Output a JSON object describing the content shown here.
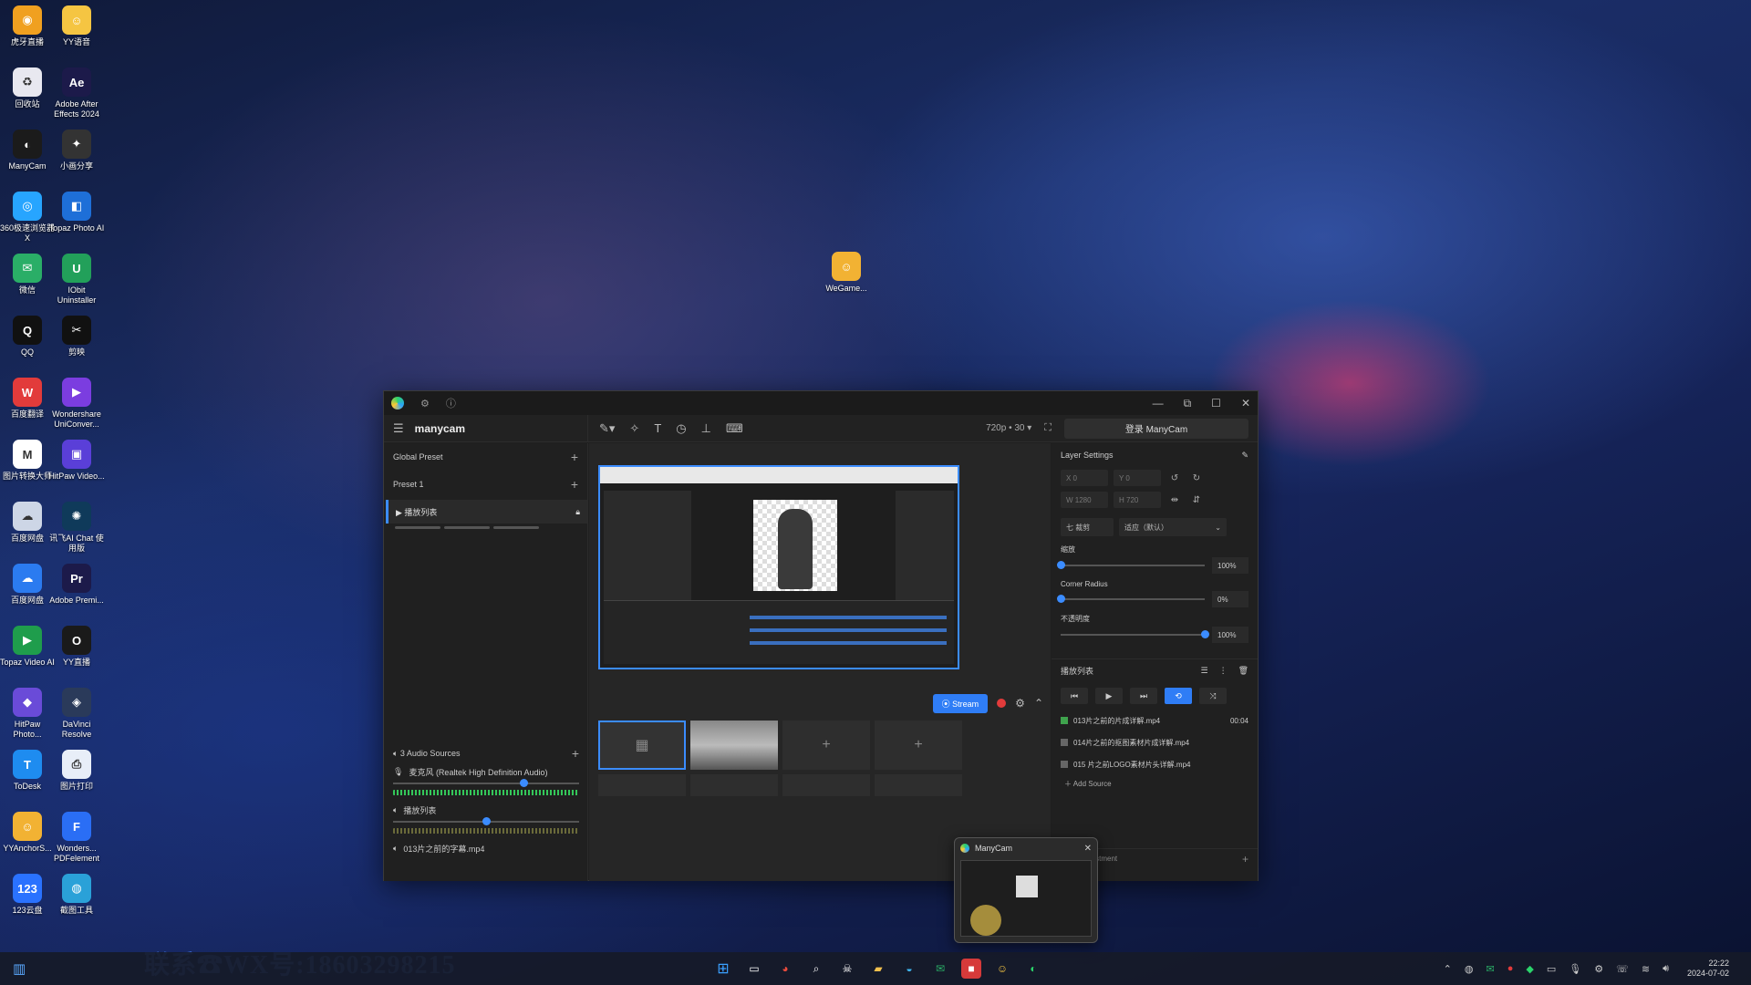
{
  "desktop": {
    "icons_col1": [
      {
        "name": "虎牙直播",
        "icon": "huya-icon",
        "color": "#f0a020",
        "glyph": "◉"
      },
      {
        "name": "回收站",
        "icon": "recycle-bin-icon",
        "color": "#e8e8f0",
        "glyph": "♻"
      },
      {
        "name": "ManyCam",
        "icon": "manycam-icon",
        "color": "#1b1b1b",
        "glyph": "◐"
      },
      {
        "name": "360极速浏览器X",
        "icon": "browser-360-icon",
        "color": "#27a5ff",
        "glyph": "◎"
      },
      {
        "name": "微信",
        "icon": "wechat-icon",
        "color": "#2aae67",
        "glyph": "✉"
      },
      {
        "name": "QQ",
        "icon": "qq-icon",
        "color": "#111111",
        "glyph": "Q"
      },
      {
        "name": "百度翻译",
        "icon": "webtts-icon",
        "color": "#e23b3b",
        "glyph": "W"
      },
      {
        "name": "图片转换大师",
        "icon": "gmail-like-icon",
        "color": "#ffffff",
        "glyph": "M"
      },
      {
        "name": "百度网盘",
        "icon": "cloud-icon",
        "color": "#cdd6e6",
        "glyph": "☁"
      },
      {
        "name": "百度网盘",
        "icon": "baidu-netdisk-icon",
        "color": "#2b7bf0",
        "glyph": "☁"
      },
      {
        "name": "Topaz Video AI",
        "icon": "topaz-icon",
        "color": "#1f9d4c",
        "glyph": "▶"
      },
      {
        "name": "HitPaw Photo...",
        "icon": "hitpaw-icon",
        "color": "#6a4bd8",
        "glyph": "◆"
      },
      {
        "name": "ToDesk",
        "icon": "todesk-icon",
        "color": "#1e8cf0",
        "glyph": "T"
      },
      {
        "name": "YYAnchorS...",
        "icon": "yy-anchor-icon",
        "color": "#f2b233",
        "glyph": "☺"
      },
      {
        "name": "123云盘",
        "icon": "cloud-123-icon",
        "color": "#2a72ff",
        "glyph": "123"
      }
    ],
    "icons_col2": [
      {
        "name": "YY语音",
        "icon": "yy-icon",
        "color": "#f5c542",
        "glyph": "☺"
      },
      {
        "name": "Adobe After Effects 2024",
        "icon": "ae-icon",
        "color": "#1c1a4a",
        "glyph": "Ae"
      },
      {
        "name": "小画分享",
        "icon": "capcut-like-icon",
        "color": "#333333",
        "glyph": "✦"
      },
      {
        "name": "Topaz Photo AI",
        "icon": "topaz-photo-icon",
        "color": "#1e6fd8",
        "glyph": "◧"
      },
      {
        "name": "IObit Uninstaller",
        "icon": "iobit-icon",
        "color": "#22a05a",
        "glyph": "U"
      },
      {
        "name": "剪映",
        "icon": "jianying-icon",
        "color": "#111111",
        "glyph": "✂"
      },
      {
        "name": "Wondershare UniConver...",
        "icon": "uniconverter-icon",
        "color": "#7b3de0",
        "glyph": "▶"
      },
      {
        "name": "HitPaw Video...",
        "icon": "hitpaw-video-icon",
        "color": "#5a3fd8",
        "glyph": "▣"
      },
      {
        "name": "讯飞AI Chat 使用版",
        "icon": "ai-chat-icon",
        "color": "#0f3a5a",
        "glyph": "✺"
      },
      {
        "name": "Adobe Premi...",
        "icon": "pr-icon",
        "color": "#1c1a4a",
        "glyph": "Pr"
      },
      {
        "name": "YY直播",
        "icon": "yy-live-icon",
        "color": "#1a1a1a",
        "glyph": "O"
      },
      {
        "name": "DaVinci Resolve",
        "icon": "davinci-icon",
        "color": "#2a3a5a",
        "glyph": "◈"
      },
      {
        "name": "图片打印",
        "icon": "printer-icon",
        "color": "#e8eef8",
        "glyph": "⎙"
      },
      {
        "name": "Wonders... PDFelement",
        "icon": "pdfelement-icon",
        "color": "#2a6ef5",
        "glyph": "F"
      },
      {
        "name": "截图工具",
        "icon": "screenshot-icon",
        "color": "#2aa1d8",
        "glyph": "◍"
      }
    ],
    "center_icon": {
      "name": "WeGame...",
      "icon": "wegame-icon",
      "color": "#f2b233",
      "glyph": "☺"
    },
    "watermark": "联系☎WX号:18603298215"
  },
  "manycam": {
    "brand": "manycam",
    "resolution": "720p • 30 ▾",
    "login_button": "登录 ManyCam",
    "left": {
      "global_preset": "Global Preset",
      "preset": "Preset 1",
      "preset_item": "播放列表",
      "audio_sources": "3 Audio Sources",
      "audio1": "麦克风 (Realtek High Definition Audio)",
      "audio2": "播放列表",
      "audio3": "013片之前的字幕.mp4",
      "audio1_level": 0.7,
      "audio2_level": 0.5
    },
    "center": {
      "stream_label": "Stream"
    },
    "right": {
      "layer_settings": "Layer Settings",
      "x_placeholder": "X 0",
      "y_placeholder": "Y 0",
      "w_placeholder": "W 1280",
      "h_placeholder": "H 720",
      "crop_label": "七 裁剪",
      "fit_select": "适应（默认）",
      "zoom_label": "缩放",
      "zoom_value": "100%",
      "zoom_level": 0.0,
      "corner_label": "Corner Radius",
      "corner_value": "0%",
      "corner_level": 0.0,
      "opacity_label": "不透明度",
      "opacity_value": "100%",
      "opacity_level": 1.0,
      "playlist_title": "播放列表",
      "files": [
        {
          "name": "013片之前的片成详解.mp4",
          "duration": "00:04"
        },
        {
          "name": "014片之前的抠图素材片成详解.mp4",
          "duration": ""
        },
        {
          "name": "015 片之前LOGO素材片头详解.mp4",
          "duration": ""
        }
      ],
      "add_source": "Add Source",
      "video_adjustment": "Video Adjustment"
    }
  },
  "popup": {
    "title": "ManyCam"
  },
  "taskbar": {
    "time": "22:22",
    "date": "2024-07-02"
  }
}
